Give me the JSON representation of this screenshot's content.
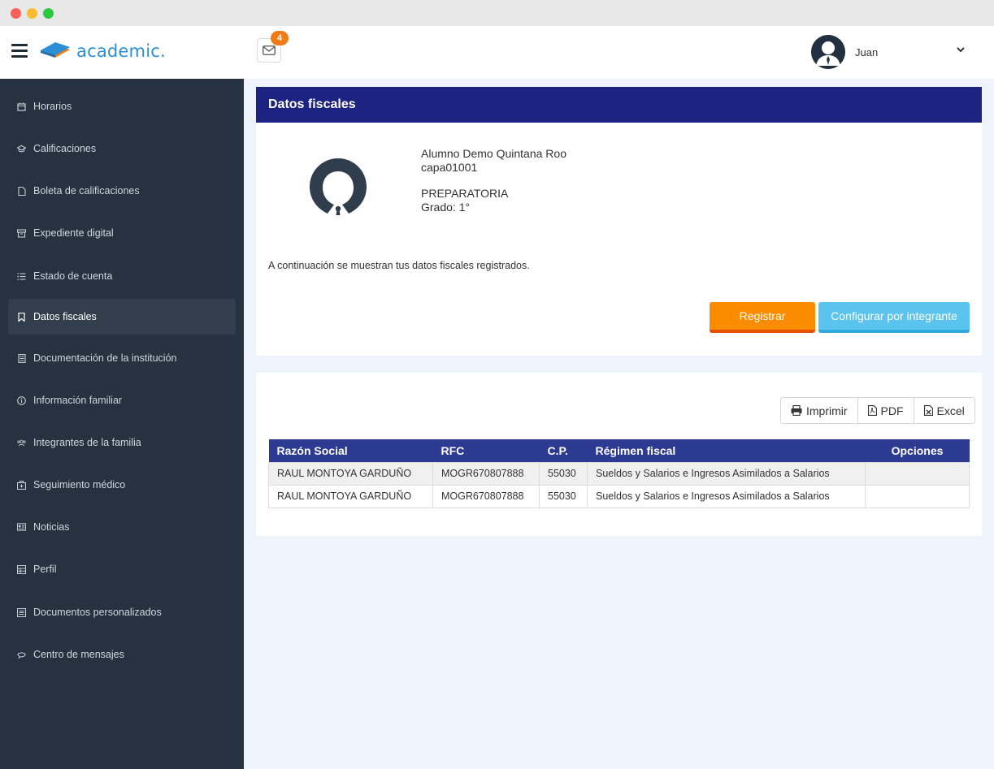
{
  "header": {
    "logo_text": "academic.",
    "mail_count": "4",
    "user_name": "Juan"
  },
  "sidebar": {
    "items": [
      {
        "label": "Horarios",
        "icon": "calendar-icon"
      },
      {
        "label": "Calificaciones",
        "icon": "graduation-cap-icon"
      },
      {
        "label": "Boleta de calificaciones",
        "icon": "file-icon"
      },
      {
        "label": "Expediente digital",
        "icon": "archive-icon"
      },
      {
        "label": "Estado de cuenta",
        "icon": "list-icon"
      },
      {
        "label": "Datos fiscales",
        "icon": "bookmark-icon",
        "active": true
      },
      {
        "label": "Documentación de la institución",
        "icon": "document-icon"
      },
      {
        "label": "Información familiar",
        "icon": "info-icon"
      },
      {
        "label": "Integrantes de la familia",
        "icon": "users-icon"
      },
      {
        "label": "Seguimiento médico",
        "icon": "medical-kit-icon"
      },
      {
        "label": "Noticias",
        "icon": "newspaper-icon"
      },
      {
        "label": "Perfil",
        "icon": "table-icon"
      },
      {
        "label": "Documentos personalizados",
        "icon": "list-alt-icon"
      },
      {
        "label": "Centro de mensajes",
        "icon": "chat-icon"
      }
    ]
  },
  "main": {
    "title": "Datos fiscales",
    "student": {
      "name": "Alumno Demo Quintana Roo",
      "code": "capa01001",
      "level": "PREPARATORIA",
      "grade": "Grado: 1°"
    },
    "intro": "A continuación se muestran tus datos fiscales registrados.",
    "register_label": "Registrar",
    "configure_label": "Configurar por integrante"
  },
  "export": {
    "print_label": "Imprimir",
    "pdf_label": "PDF",
    "excel_label": "Excel"
  },
  "table": {
    "headers": [
      "Razón Social",
      "RFC",
      "C.P.",
      "Régimen fiscal",
      "Opciones"
    ],
    "rows": [
      [
        "RAUL MONTOYA GARDUÑO",
        "MOGR670807888",
        "55030",
        "Sueldos y Salarios e Ingresos Asimilados a Salarios",
        ""
      ],
      [
        "RAUL MONTOYA GARDUÑO",
        "MOGR670807888",
        "55030",
        "Sueldos y Salarios e Ingresos Asimilados a Salarios",
        ""
      ]
    ]
  },
  "colors": {
    "sidebar_bg": "#263240",
    "header_blue": "#1c2380",
    "table_head": "#2d3a92",
    "orange": "#fb8c00",
    "sky": "#5bc4ee"
  }
}
